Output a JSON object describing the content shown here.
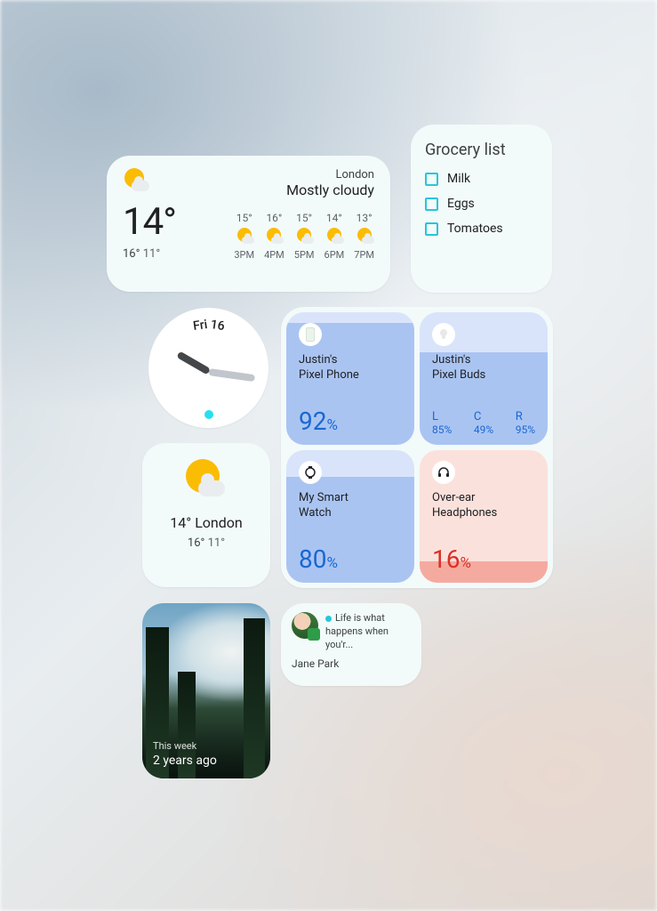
{
  "weather_wide": {
    "city": "London",
    "condition": "Mostly cloudy",
    "current_temp": "14°",
    "high": "16°",
    "low": "11°",
    "hours": [
      {
        "temp": "15°",
        "time": "3PM"
      },
      {
        "temp": "16°",
        "time": "4PM"
      },
      {
        "temp": "15°",
        "time": "5PM"
      },
      {
        "temp": "14°",
        "time": "6PM"
      },
      {
        "temp": "13°",
        "time": "7PM"
      }
    ]
  },
  "grocery": {
    "title": "Grocery list",
    "items": [
      "Milk",
      "Eggs",
      "Tomatoes"
    ]
  },
  "clock": {
    "weekday": "Fri",
    "day": "16"
  },
  "battery": {
    "tiles": [
      {
        "name": "Justin's\nPixel Phone",
        "percent": "92",
        "icon": "phone"
      },
      {
        "name": "Justin's\nPixel Buds",
        "icon": "buds",
        "buds": [
          {
            "label": "L",
            "pct": "85%"
          },
          {
            "label": "C",
            "pct": "49%"
          },
          {
            "label": "R",
            "pct": "95%"
          }
        ]
      },
      {
        "name": "My Smart\nWatch",
        "percent": "80",
        "icon": "watch"
      },
      {
        "name": "Over-ear\nHeadphones",
        "percent": "16",
        "icon": "headphones"
      }
    ]
  },
  "weather_small": {
    "city": "London",
    "temp": "14°",
    "high": "16°",
    "low": "11°"
  },
  "photo": {
    "subtitle": "This week",
    "title": "2 years ago"
  },
  "message": {
    "preview": "Life is what happens when you'r...",
    "sender": "Jane Park"
  }
}
